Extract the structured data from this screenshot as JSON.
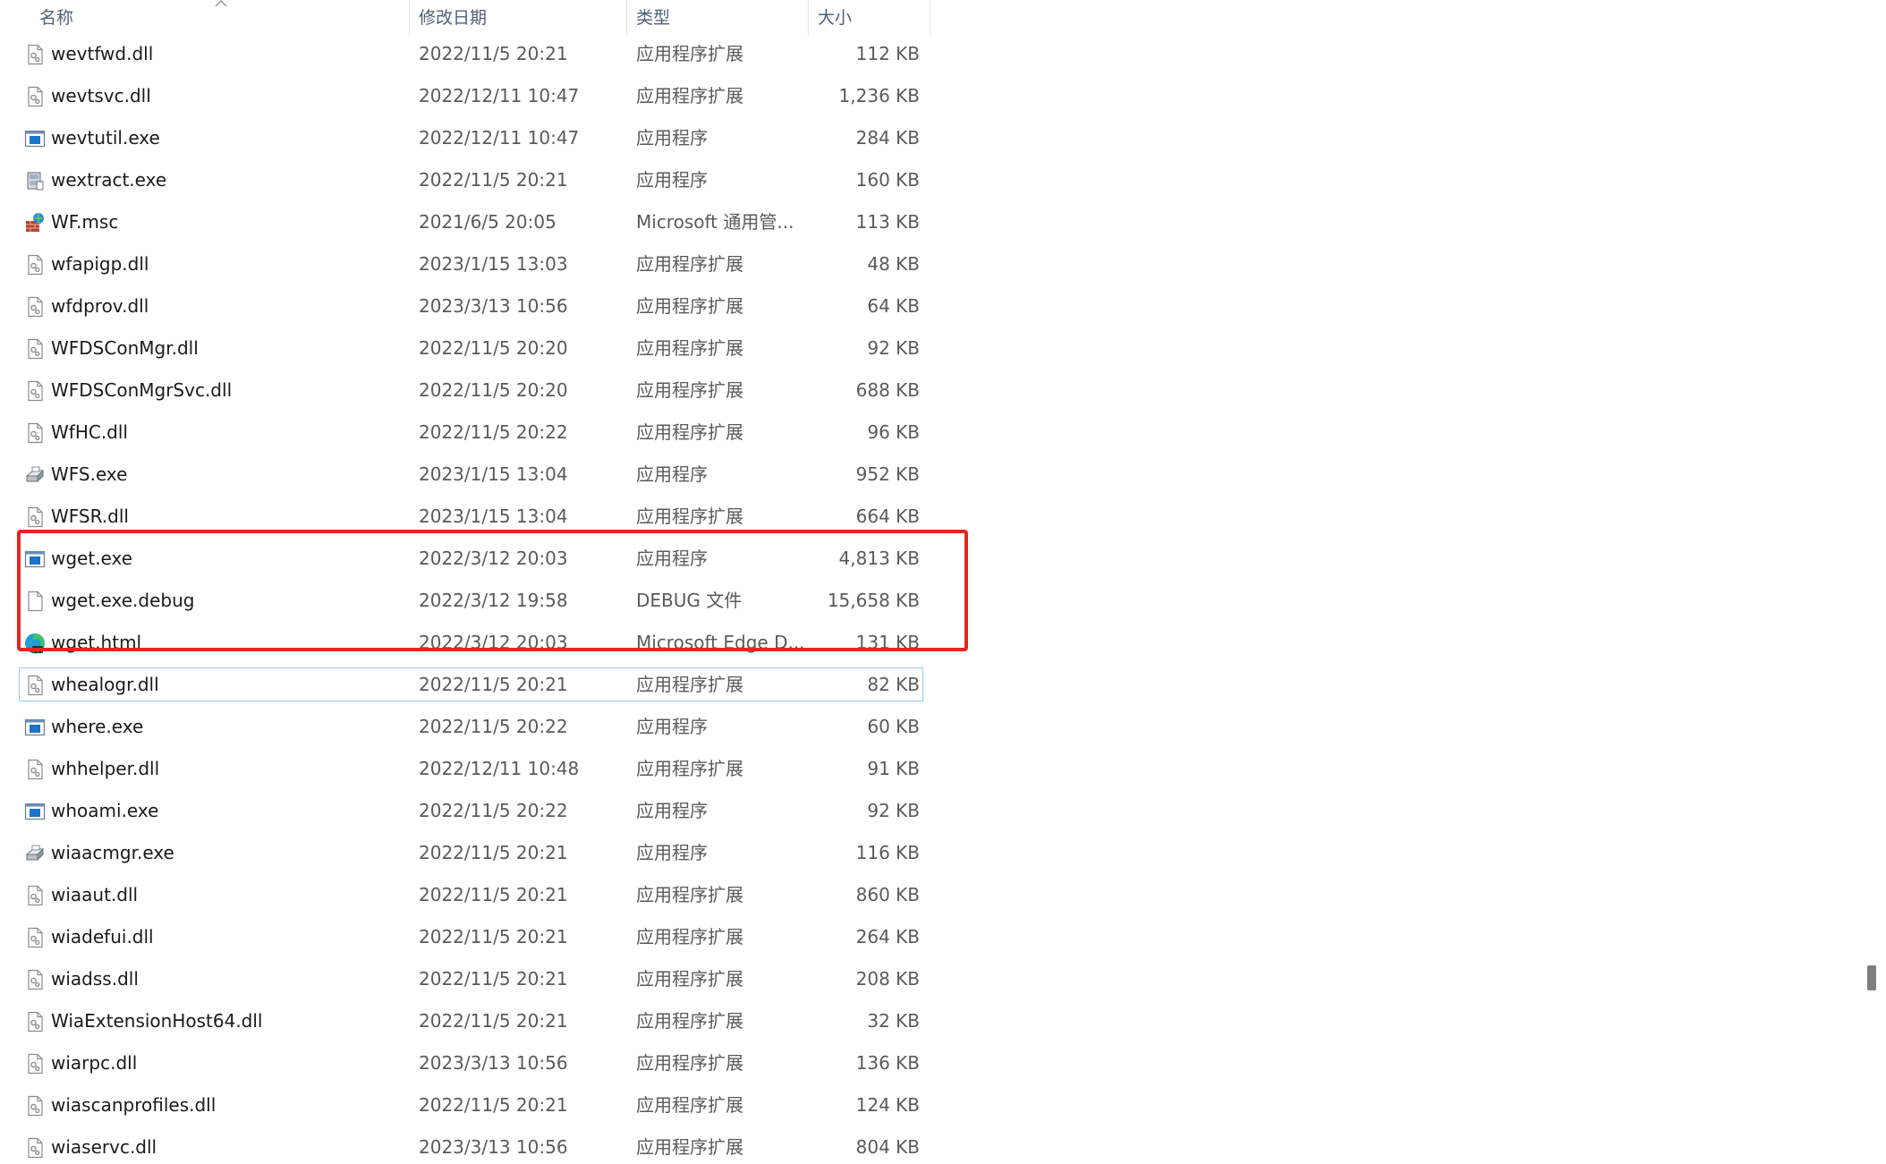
{
  "columns": {
    "name": "名称",
    "date": "修改日期",
    "type": "类型",
    "size": "大小"
  },
  "files": [
    {
      "name": "wevtfwd.dll",
      "date": "2022/11/5 20:21",
      "type": "应用程序扩展",
      "size": "112 KB",
      "icon": "dll-file-icon"
    },
    {
      "name": "wevtsvc.dll",
      "date": "2022/12/11 10:47",
      "type": "应用程序扩展",
      "size": "1,236 KB",
      "icon": "dll-file-icon"
    },
    {
      "name": "wevtutil.exe",
      "date": "2022/12/11 10:47",
      "type": "应用程序",
      "size": "284 KB",
      "icon": "exe-window-icon"
    },
    {
      "name": "wextract.exe",
      "date": "2022/11/5 20:21",
      "type": "应用程序",
      "size": "160 KB",
      "icon": "cabinet-icon"
    },
    {
      "name": "WF.msc",
      "date": "2021/6/5 20:05",
      "type": "Microsoft 通用管...",
      "size": "113 KB",
      "icon": "firewall-icon"
    },
    {
      "name": "wfapigp.dll",
      "date": "2023/1/15 13:03",
      "type": "应用程序扩展",
      "size": "48 KB",
      "icon": "dll-file-icon"
    },
    {
      "name": "wfdprov.dll",
      "date": "2023/3/13 10:56",
      "type": "应用程序扩展",
      "size": "64 KB",
      "icon": "dll-file-icon"
    },
    {
      "name": "WFDSConMgr.dll",
      "date": "2022/11/5 20:20",
      "type": "应用程序扩展",
      "size": "92 KB",
      "icon": "dll-file-icon"
    },
    {
      "name": "WFDSConMgrSvc.dll",
      "date": "2022/11/5 20:20",
      "type": "应用程序扩展",
      "size": "688 KB",
      "icon": "dll-file-icon"
    },
    {
      "name": "WfHC.dll",
      "date": "2022/11/5 20:22",
      "type": "应用程序扩展",
      "size": "96 KB",
      "icon": "dll-file-icon"
    },
    {
      "name": "WFS.exe",
      "date": "2023/1/15 13:04",
      "type": "应用程序",
      "size": "952 KB",
      "icon": "fax-scanner-icon"
    },
    {
      "name": "WFSR.dll",
      "date": "2023/1/15 13:04",
      "type": "应用程序扩展",
      "size": "664 KB",
      "icon": "dll-file-icon"
    },
    {
      "name": "wget.exe",
      "date": "2022/3/12 20:03",
      "type": "应用程序",
      "size": "4,813 KB",
      "icon": "exe-window-icon"
    },
    {
      "name": "wget.exe.debug",
      "date": "2022/3/12 19:58",
      "type": "DEBUG 文件",
      "size": "15,658 KB",
      "icon": "blank-file-icon"
    },
    {
      "name": "wget.html",
      "date": "2022/3/12 20:03",
      "type": "Microsoft Edge D...",
      "size": "131 KB",
      "icon": "edge-dev-icon"
    },
    {
      "name": "whealogr.dll",
      "date": "2022/11/5 20:21",
      "type": "应用程序扩展",
      "size": "82 KB",
      "icon": "dll-file-icon"
    },
    {
      "name": "where.exe",
      "date": "2022/11/5 20:22",
      "type": "应用程序",
      "size": "60 KB",
      "icon": "exe-window-icon"
    },
    {
      "name": "whhelper.dll",
      "date": "2022/12/11 10:48",
      "type": "应用程序扩展",
      "size": "91 KB",
      "icon": "dll-file-icon"
    },
    {
      "name": "whoami.exe",
      "date": "2022/11/5 20:22",
      "type": "应用程序",
      "size": "92 KB",
      "icon": "exe-window-icon"
    },
    {
      "name": "wiaacmgr.exe",
      "date": "2022/11/5 20:21",
      "type": "应用程序",
      "size": "116 KB",
      "icon": "fax-scanner-icon"
    },
    {
      "name": "wiaaut.dll",
      "date": "2022/11/5 20:21",
      "type": "应用程序扩展",
      "size": "860 KB",
      "icon": "dll-file-icon"
    },
    {
      "name": "wiadefui.dll",
      "date": "2022/11/5 20:21",
      "type": "应用程序扩展",
      "size": "264 KB",
      "icon": "dll-file-icon"
    },
    {
      "name": "wiadss.dll",
      "date": "2022/11/5 20:21",
      "type": "应用程序扩展",
      "size": "208 KB",
      "icon": "dll-file-icon"
    },
    {
      "name": "WiaExtensionHost64.dll",
      "date": "2022/11/5 20:21",
      "type": "应用程序扩展",
      "size": "32 KB",
      "icon": "dll-file-icon"
    },
    {
      "name": "wiarpc.dll",
      "date": "2023/3/13 10:56",
      "type": "应用程序扩展",
      "size": "136 KB",
      "icon": "dll-file-icon"
    },
    {
      "name": "wiascanprofiles.dll",
      "date": "2022/11/5 20:21",
      "type": "应用程序扩展",
      "size": "124 KB",
      "icon": "dll-file-icon"
    },
    {
      "name": "wiaservc.dll",
      "date": "2023/3/13 10:56",
      "type": "应用程序扩展",
      "size": "804 KB",
      "icon": "dll-file-icon"
    }
  ],
  "focused_row_index": 15,
  "highlighted_rows": [
    12,
    13,
    14
  ],
  "colors": {
    "header_text": "#4c607a",
    "highlight_border": "#e8241f",
    "focus_border": "#99c9ef",
    "date_text": "#5a5a5a"
  }
}
